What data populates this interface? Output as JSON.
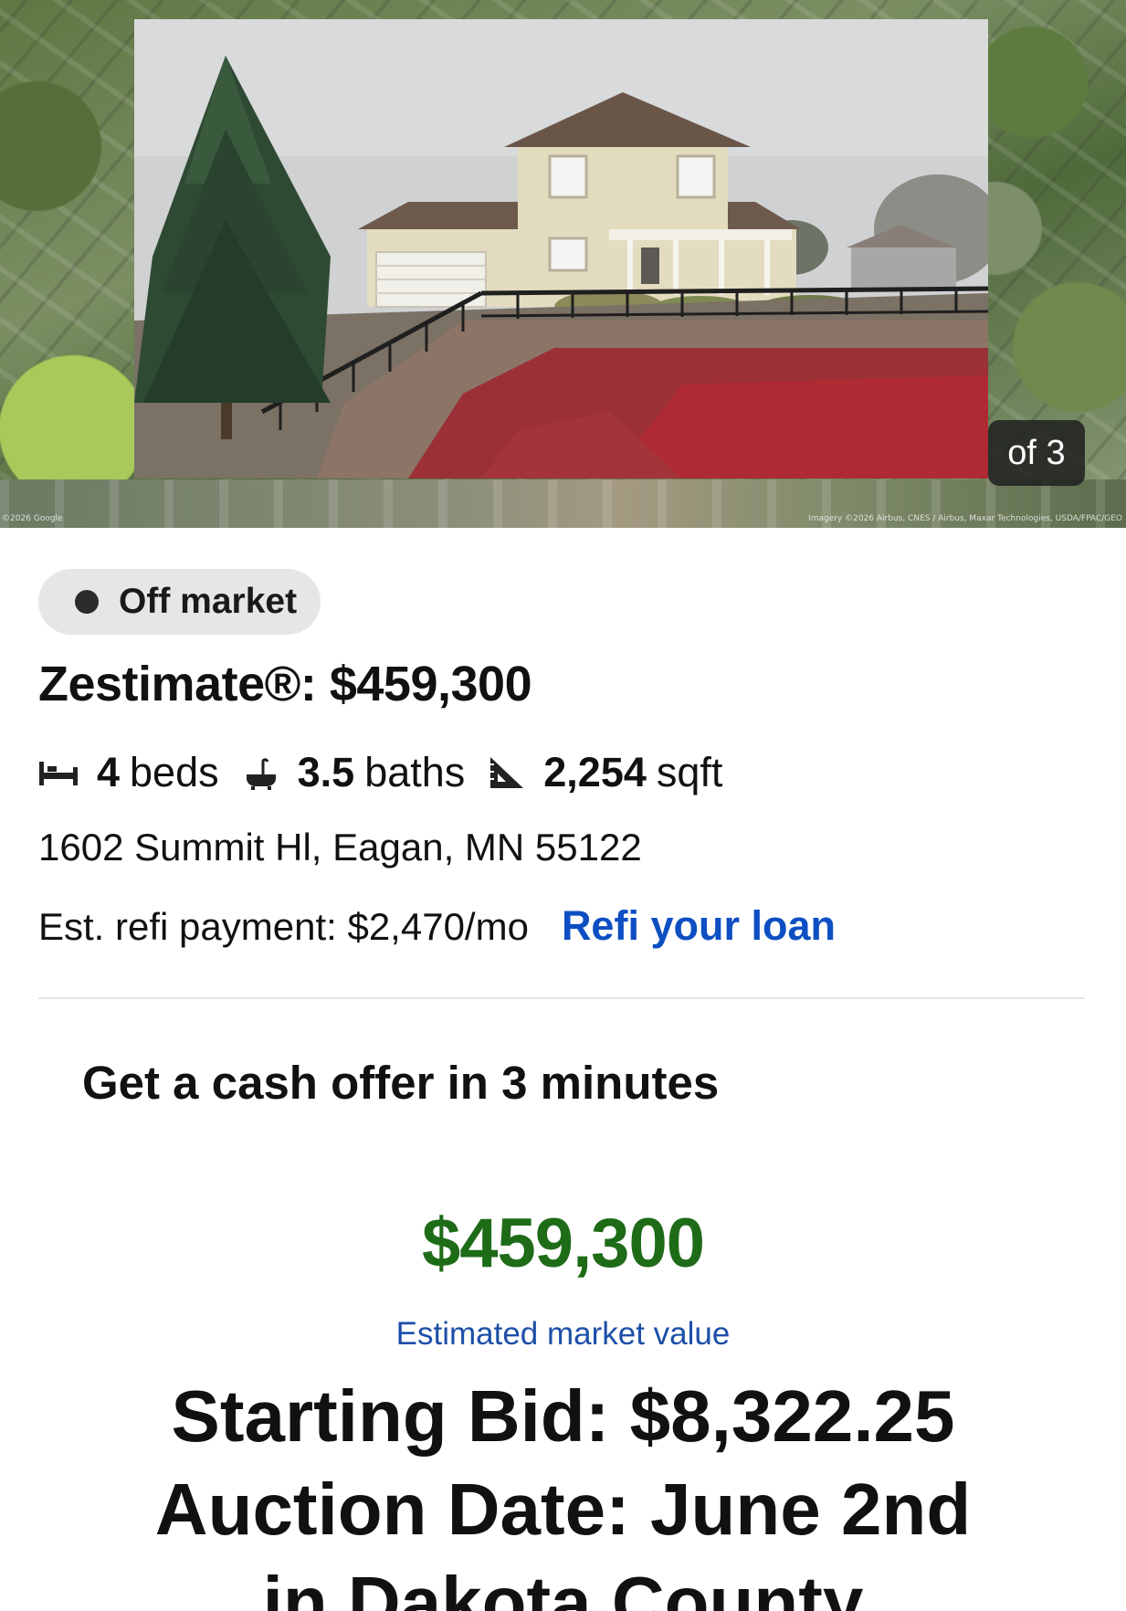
{
  "hero": {
    "photo_counter": "of 3",
    "credit_left": "©2026 Google",
    "credit_right": "Imagery ©2026 Airbus, CNES / Airbus, Maxar Technologies, USDA/FPAC/GEO"
  },
  "listing": {
    "status": "Off market",
    "zestimate": "Zestimate®: $459,300",
    "beds_value": "4",
    "beds_unit": "beds",
    "baths_value": "3.5",
    "baths_unit": "baths",
    "sqft_value": "2,254",
    "sqft_unit": "sqft",
    "address": "1602 Summit Hl, Eagan, MN 55122",
    "refi_payment": "Est. refi payment: $2,470/mo",
    "refi_link": "Refi your loan"
  },
  "cash_offer": {
    "heading": "Get a cash offer in 3 minutes",
    "value": "$459,300",
    "caption": "Estimated market value"
  },
  "auction": {
    "line1": "Starting Bid: $8,322.25",
    "line2": "Auction Date: June 2nd",
    "line3": "in Dakota County"
  },
  "colors": {
    "link_blue": "#0d4fc2",
    "value_green": "#1e6b18",
    "caption_blue": "#1d4fa8"
  },
  "icons": [
    "bed-icon",
    "bath-icon",
    "sqft-ruler-icon",
    "status-dot-icon"
  ]
}
